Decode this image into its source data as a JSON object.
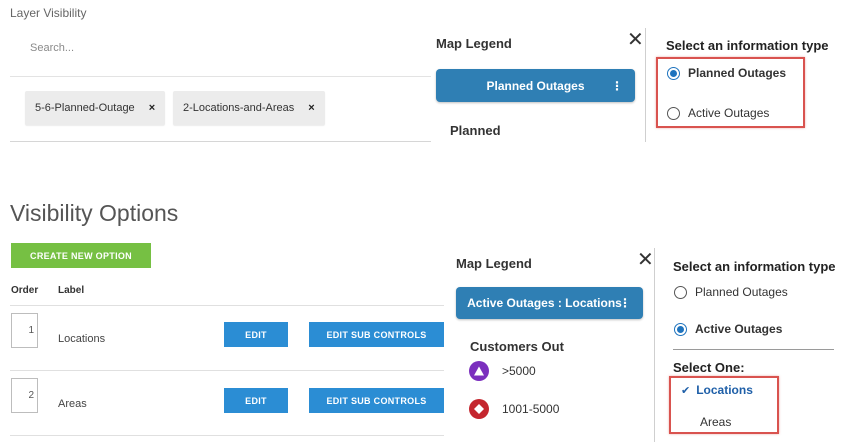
{
  "layer_visibility": {
    "title": "Layer Visibility",
    "search_placeholder": "Search...",
    "chips": [
      {
        "label": "5-6-Planned-Outage",
        "remove": "×"
      },
      {
        "label": "2-Locations-and-Areas",
        "remove": "×"
      }
    ]
  },
  "legend_top": {
    "title": "Map Legend",
    "close": "✕",
    "button_label": "Planned Outages",
    "button_menu": "⋮",
    "section": "Planned"
  },
  "info_top": {
    "title": "Select an information type",
    "options": [
      {
        "label": "Planned Outages",
        "selected": true
      },
      {
        "label": "Active Outages",
        "selected": false
      }
    ]
  },
  "visibility_options": {
    "title": "Visibility Options",
    "create_button": "CREATE NEW OPTION",
    "columns": {
      "order": "Order",
      "label": "Label"
    },
    "rows": [
      {
        "order": "1",
        "label": "Locations",
        "edit": "EDIT",
        "edit_sub": "EDIT SUB CONTROLS"
      },
      {
        "order": "2",
        "label": "Areas",
        "edit": "EDIT",
        "edit_sub": "EDIT SUB CONTROLS"
      }
    ]
  },
  "legend_bottom": {
    "title": "Map Legend",
    "close": "✕",
    "button_label": "Active Outages : Locations",
    "button_menu": "⋮",
    "section": "Customers Out",
    "items": [
      {
        "label": ">5000",
        "color": "#7b2fbe",
        "icon": "triangle-icon"
      },
      {
        "label": "1001-5000",
        "color": "#c4262e",
        "icon": "diamond-icon"
      }
    ]
  },
  "info_bottom": {
    "title": "Select an information type",
    "options": [
      {
        "label": "Planned Outages",
        "selected": false
      },
      {
        "label": "Active Outages",
        "selected": true
      }
    ],
    "select_one": "Select One:",
    "choices": [
      {
        "label": "Locations",
        "checked": true,
        "check": "✔"
      },
      {
        "label": "Areas",
        "checked": false
      }
    ]
  },
  "colors": {
    "legend_button": "#2f7fb4",
    "create_button": "#76c043",
    "edit_button": "#2b8dd4",
    "highlight_box": "#d9534f",
    "radio_selected": "#1e73be"
  }
}
